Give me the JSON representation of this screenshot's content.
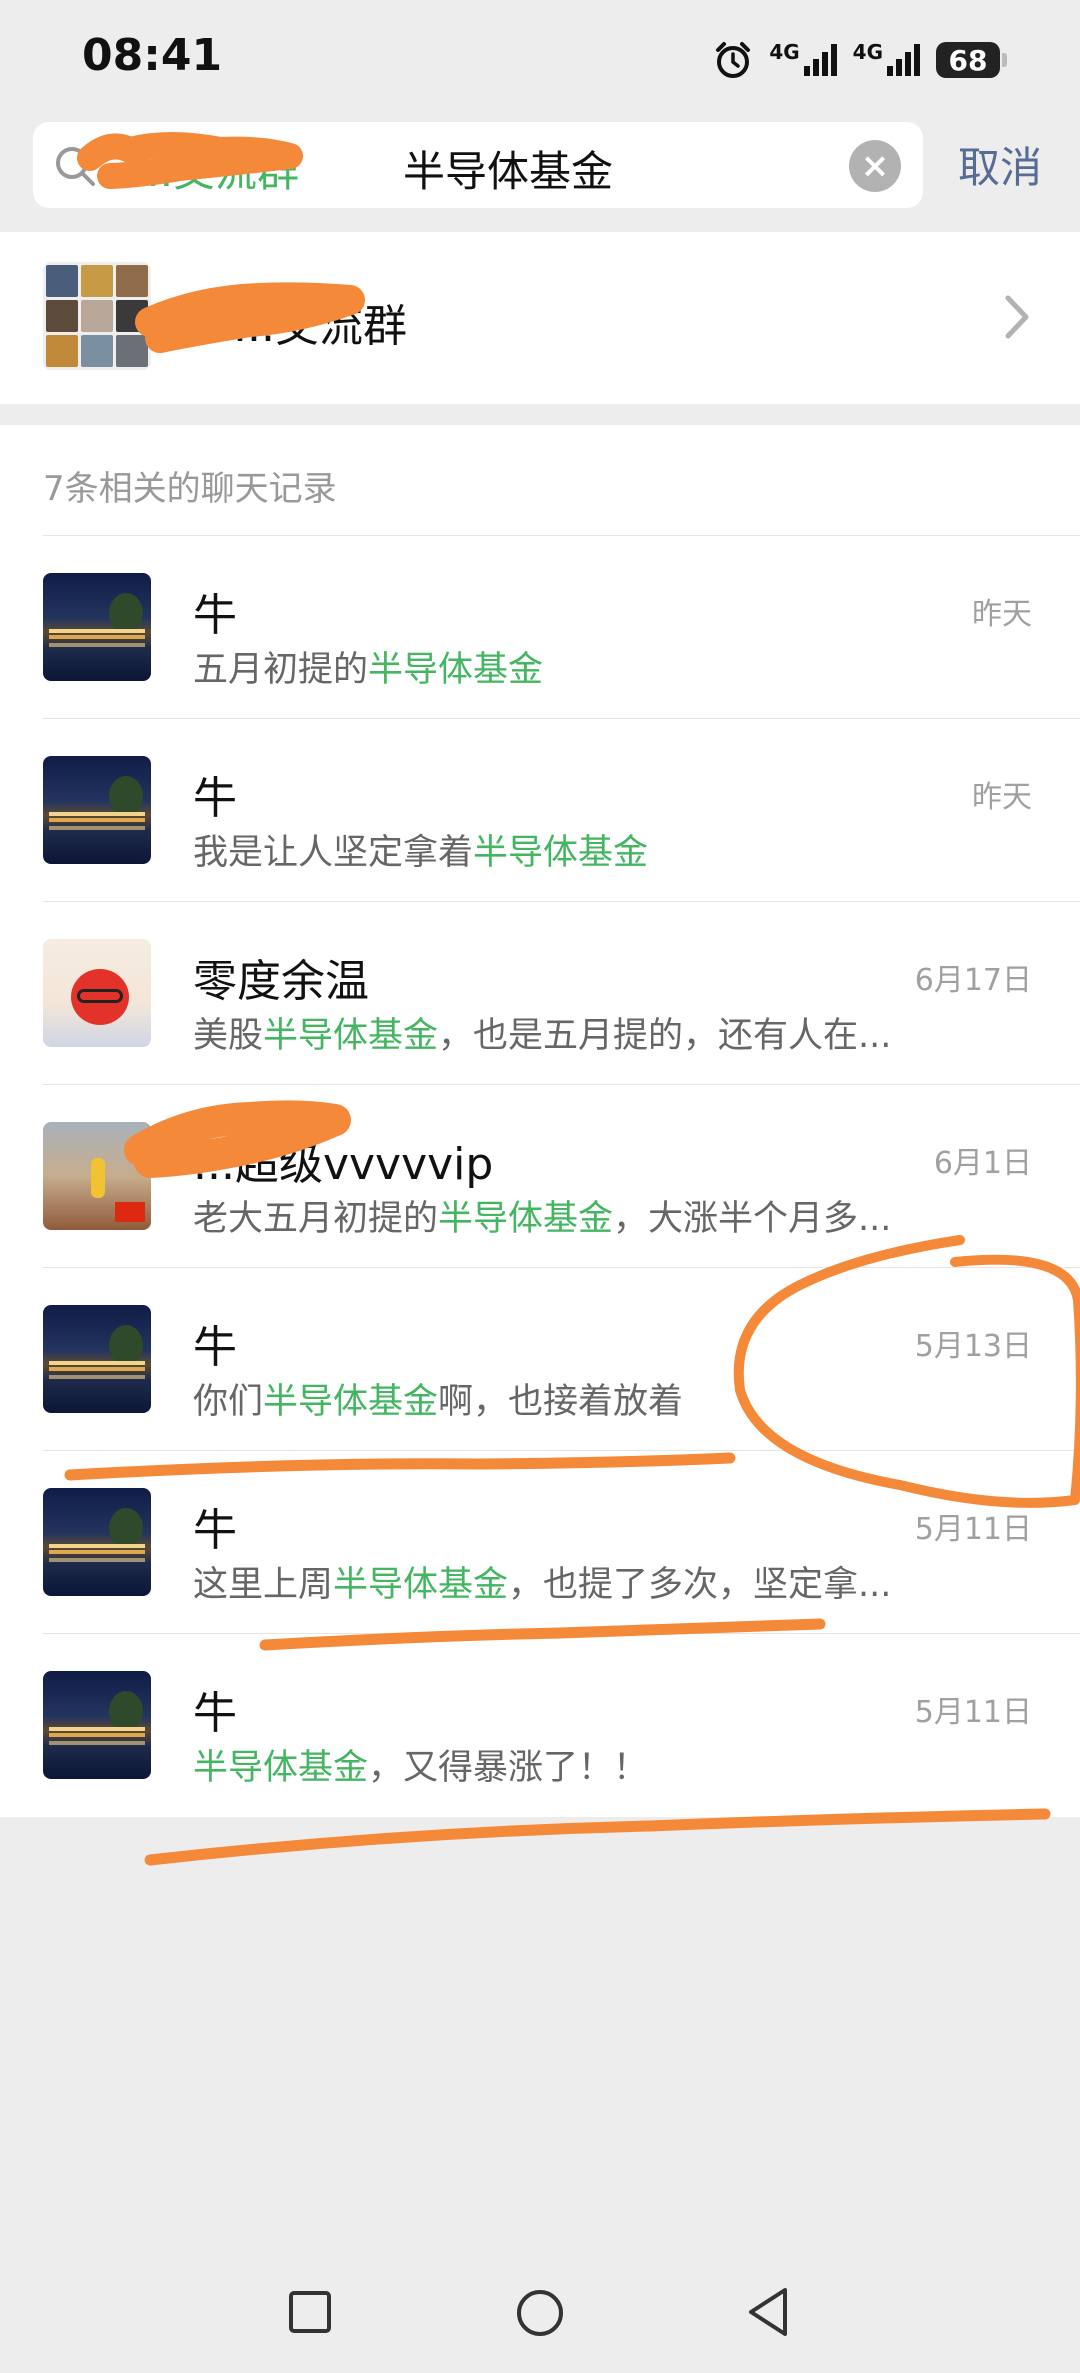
{
  "status_bar": {
    "time": "08:41",
    "network_1": "4G",
    "network_2": "4G",
    "battery": "68"
  },
  "search": {
    "tag_text": "...交流群",
    "query": "半导体基金",
    "cancel_label": "取消"
  },
  "group_result": {
    "name": "...交流群"
  },
  "records": {
    "header": "7条相关的聊天记录",
    "items": [
      {
        "title": "牛",
        "time": "昨天",
        "pre": "五月初提的",
        "hl": "半导体基金",
        "post": ""
      },
      {
        "title": "牛",
        "time": "昨天",
        "pre": "我是让人坚定拿着",
        "hl": "半导体基金",
        "post": ""
      },
      {
        "title": "零度余温",
        "time": "6月17日",
        "pre": "美股",
        "hl": "半导体基金",
        "post": "，也是五月提的，还有人在..."
      },
      {
        "title": "...超级vvvvvip",
        "time": "6月1日",
        "pre": "老大五月初提的",
        "hl": "半导体基金",
        "post": "，大涨半个月多..."
      },
      {
        "title": "牛",
        "time": "5月13日",
        "pre": "你们",
        "hl": "半导体基金",
        "post": "啊，也接着放着"
      },
      {
        "title": "牛",
        "time": "5月11日",
        "pre": "这里上周",
        "hl": "半导体基金",
        "post": "，也提了多次，坚定拿..."
      },
      {
        "title": "牛",
        "time": "5月11日",
        "pre": "",
        "hl": "半导体基金",
        "post": "，又得暴涨了！！"
      }
    ]
  },
  "colors": {
    "highlight": "#44b561",
    "link": "#576b95",
    "annotation": "#f5893a"
  }
}
